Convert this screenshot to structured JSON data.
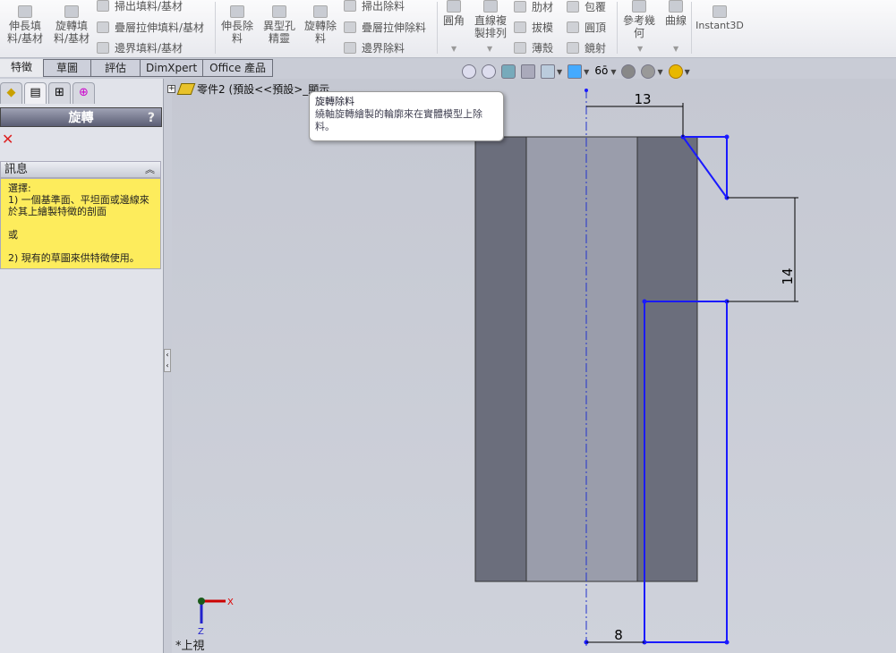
{
  "ribbon": {
    "large_buttons": [
      "伸長填\n料/基材",
      "旋轉填\n料/基材",
      "伸長除\n料",
      "異型孔\n精靈",
      "旋轉除\n料",
      "圓角",
      "直線複\n製排列",
      "參考幾\n何",
      "曲線",
      "Instant3D"
    ],
    "small_buttons": [
      "掃出填料/基材",
      "疊層拉伸填料/基材",
      "邊界填料/基材",
      "掃出除料",
      "疊層拉伸除料",
      "邊界除料",
      "肋材",
      "拔模",
      "薄殼",
      "包覆",
      "圓頂",
      "鏡射"
    ]
  },
  "tabs": [
    "特徵",
    "草圖",
    "評估",
    "DimXpert",
    "Office 產品"
  ],
  "panel": {
    "title": "旋轉",
    "help": "?",
    "message_header": "訊息",
    "message_lines": [
      "選擇:",
      "1) 一個基準面、平坦面或邊線來於其上繪製特徵的剖面",
      "",
      "或",
      "",
      "2) 現有的草圖來供特徵使用。"
    ]
  },
  "tree": {
    "root": "零件2 (預設<<預設>_顯示"
  },
  "tooltip": {
    "title": "旋轉除料",
    "desc": "繞軸旋轉繪製的輪廓來在實體模型上除料。"
  },
  "dimensions": {
    "top": "13",
    "right": "14",
    "bottom": "8"
  },
  "triad": {
    "x": "X",
    "z": "Z",
    "view": "*上視"
  },
  "colors": {
    "sketch": "#1a1aff",
    "body_dark": "#6b6e7c",
    "body_light": "#9a9dab"
  }
}
